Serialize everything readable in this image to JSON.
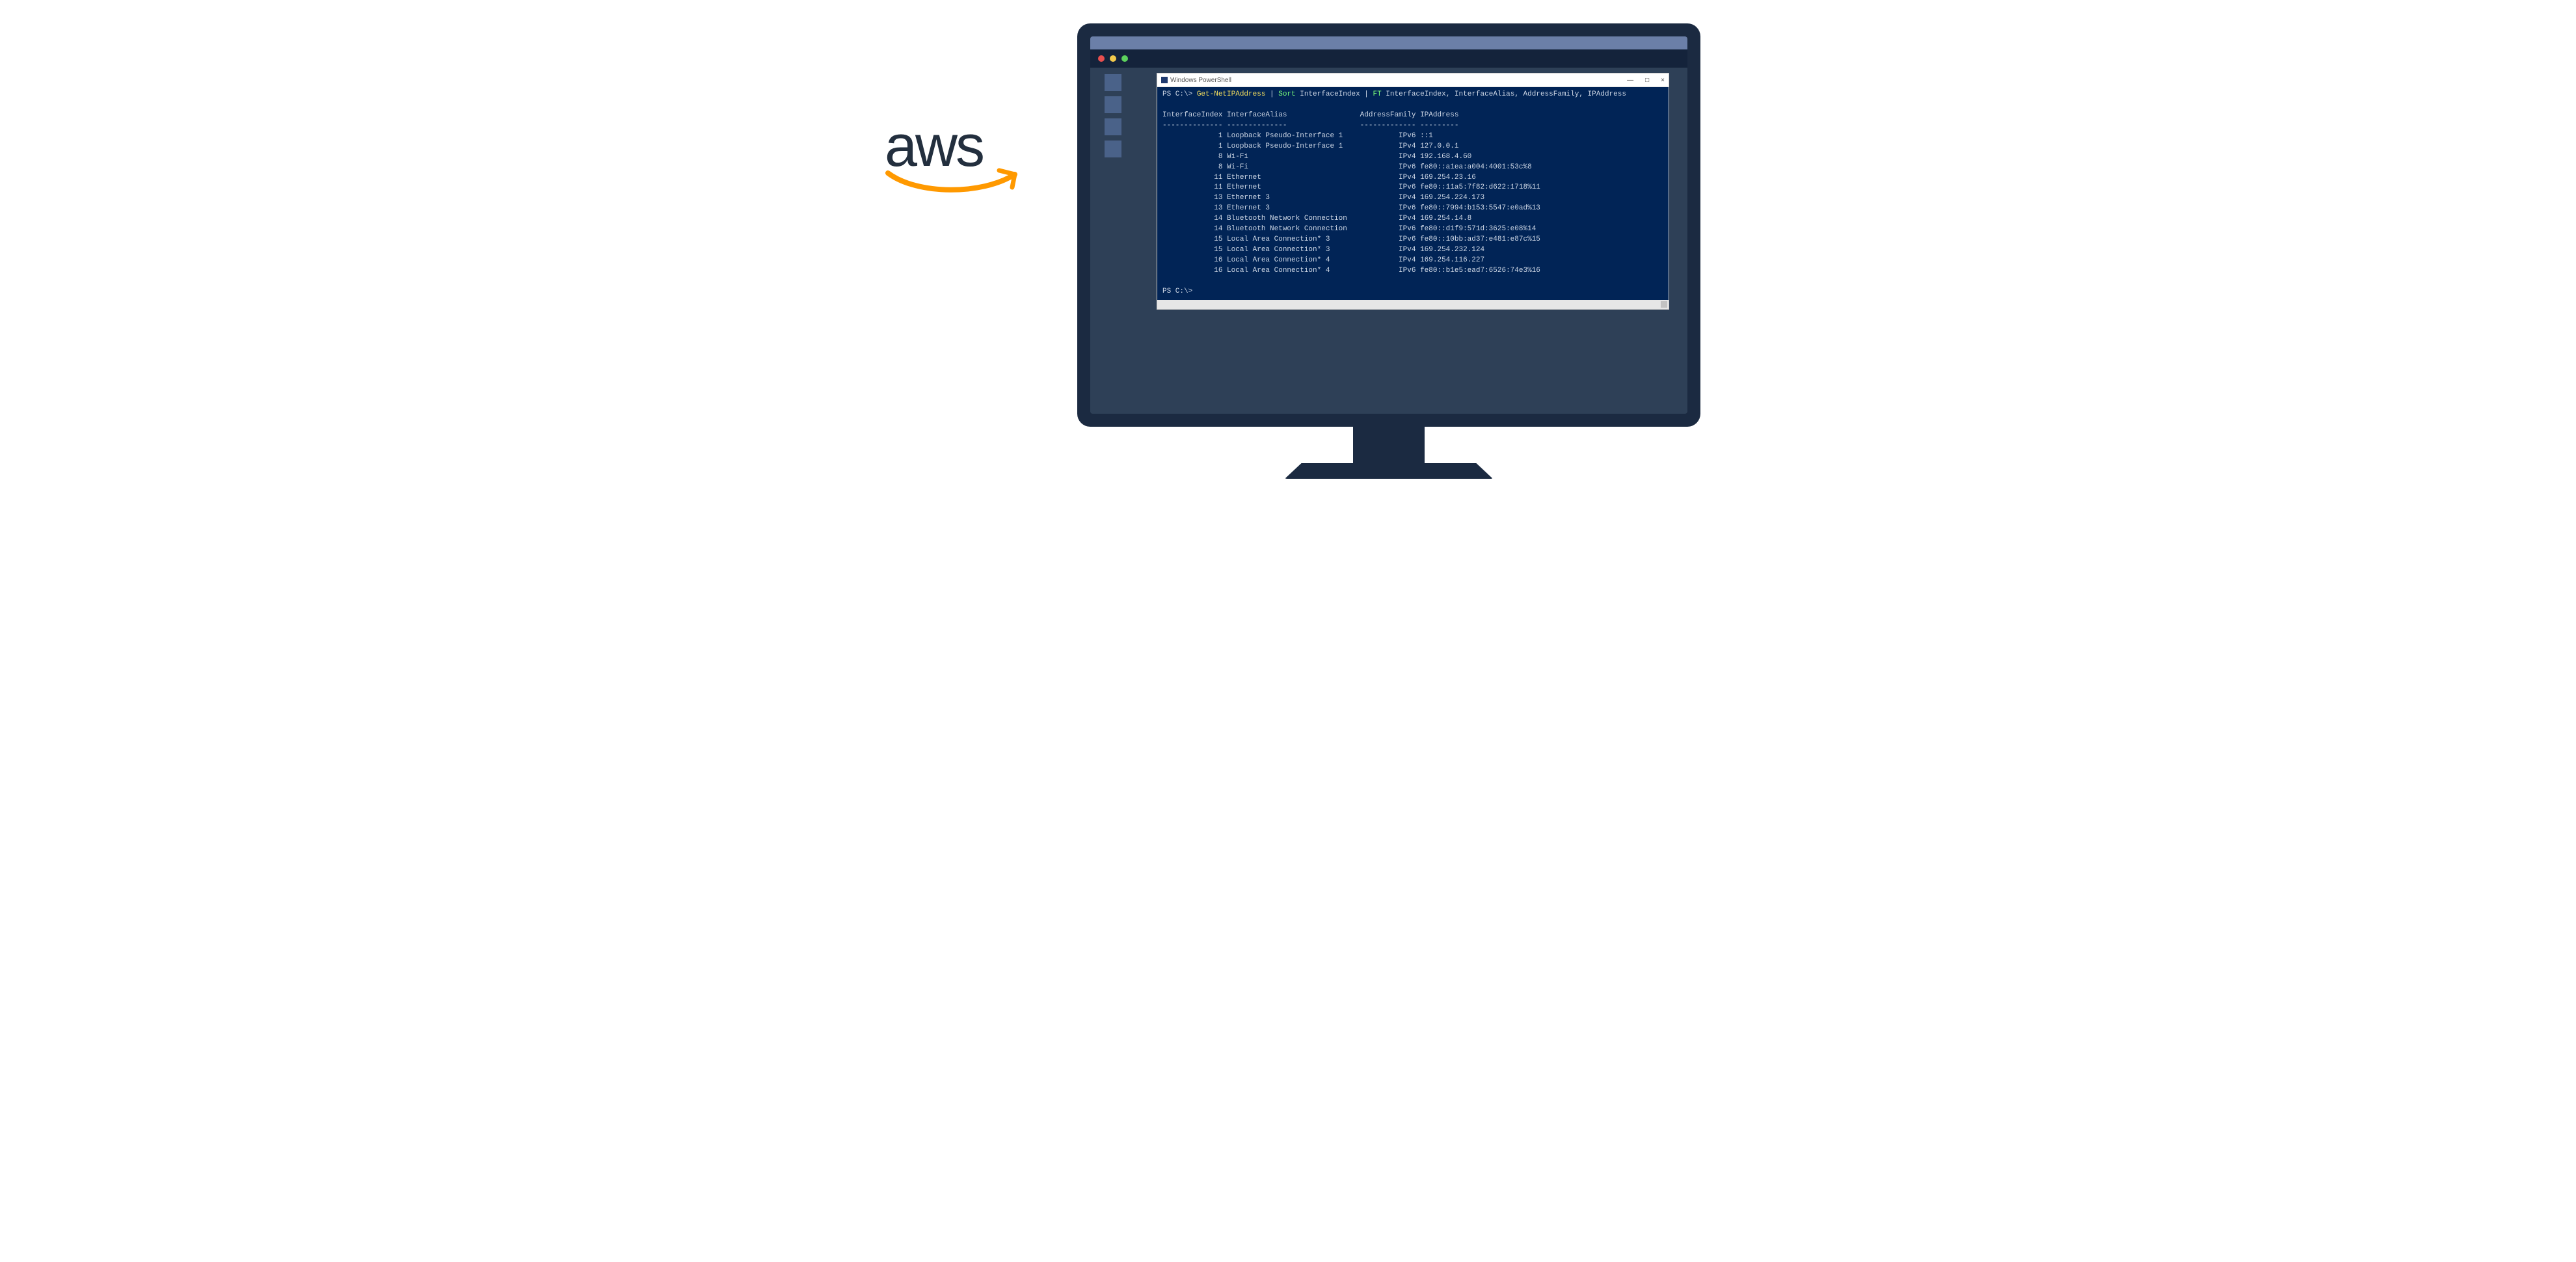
{
  "aws": {
    "text": "aws"
  },
  "traffic_lights": [
    "red",
    "yellow",
    "green"
  ],
  "powershell": {
    "title": "Windows PowerShell",
    "window_controls": {
      "min": "—",
      "max": "□",
      "close": "×"
    },
    "prompt_prefix": "PS C:\\>",
    "cmdline": {
      "cmd": "Get-NetIPAddress",
      "sort": "Sort",
      "sort_arg": "InterfaceIndex",
      "ft": "FT",
      "ft_args": "InterfaceIndex, InterfaceAlias, AddressFamily, IPAddress"
    },
    "headers": {
      "col1": "InterfaceIndex",
      "col2": "InterfaceAlias",
      "col3": "AddressFamily",
      "col4": "IPAddress"
    },
    "rows": [
      {
        "idx": "1",
        "alias": "Loopback Pseudo-Interface 1",
        "fam": "IPv6",
        "ip": "::1"
      },
      {
        "idx": "1",
        "alias": "Loopback Pseudo-Interface 1",
        "fam": "IPv4",
        "ip": "127.0.0.1"
      },
      {
        "idx": "8",
        "alias": "Wi-Fi",
        "fam": "IPv4",
        "ip": "192.168.4.60"
      },
      {
        "idx": "8",
        "alias": "Wi-Fi",
        "fam": "IPv6",
        "ip": "fe80::a1ea:a004:4001:53c%8"
      },
      {
        "idx": "11",
        "alias": "Ethernet",
        "fam": "IPv4",
        "ip": "169.254.23.16"
      },
      {
        "idx": "11",
        "alias": "Ethernet",
        "fam": "IPv6",
        "ip": "fe80::11a5:7f82:d622:1718%11"
      },
      {
        "idx": "13",
        "alias": "Ethernet 3",
        "fam": "IPv4",
        "ip": "169.254.224.173"
      },
      {
        "idx": "13",
        "alias": "Ethernet 3",
        "fam": "IPv6",
        "ip": "fe80::7994:b153:5547:e0ad%13"
      },
      {
        "idx": "14",
        "alias": "Bluetooth Network Connection",
        "fam": "IPv4",
        "ip": "169.254.14.8"
      },
      {
        "idx": "14",
        "alias": "Bluetooth Network Connection",
        "fam": "IPv6",
        "ip": "fe80::d1f9:571d:3625:e08%14"
      },
      {
        "idx": "15",
        "alias": "Local Area Connection* 3",
        "fam": "IPv6",
        "ip": "fe80::10bb:ad37:e481:e87c%15"
      },
      {
        "idx": "15",
        "alias": "Local Area Connection* 3",
        "fam": "IPv4",
        "ip": "169.254.232.124"
      },
      {
        "idx": "16",
        "alias": "Local Area Connection* 4",
        "fam": "IPv4",
        "ip": "169.254.116.227"
      },
      {
        "idx": "16",
        "alias": "Local Area Connection* 4",
        "fam": "IPv6",
        "ip": "fe80::b1e5:ead7:6526:74e3%16"
      }
    ],
    "final_prompt": "PS C:\\>"
  }
}
